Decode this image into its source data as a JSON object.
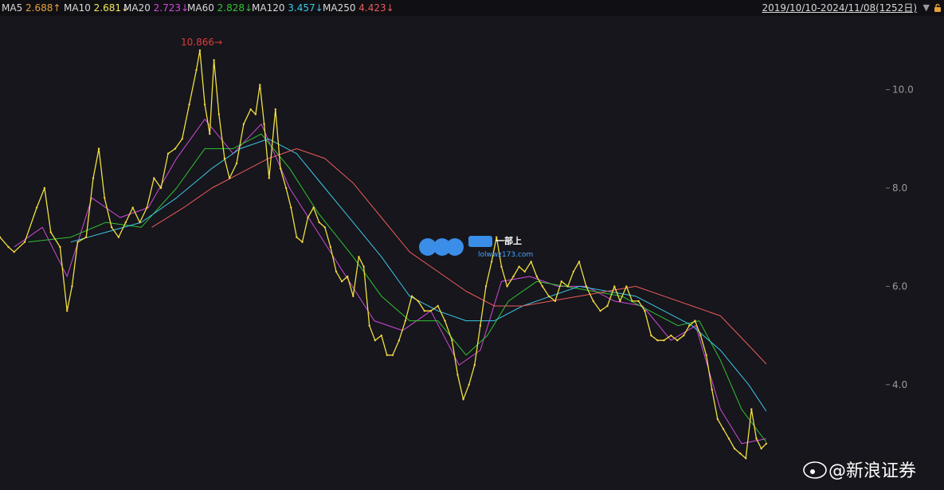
{
  "header": {
    "ma_items": [
      {
        "label": "MA5",
        "value": "2.688↑",
        "color": "#e6a23c"
      },
      {
        "label": "MA10",
        "value": "2.681↓",
        "color": "#f5e85a"
      },
      {
        "label": "MA20",
        "value": "2.723↓",
        "color": "#d04bd8"
      },
      {
        "label": "MA60",
        "value": "2.828↓",
        "color": "#32c232"
      },
      {
        "label": "MA120",
        "value": "3.457↓",
        "color": "#3cc8e6"
      },
      {
        "label": "MA250",
        "value": "4.423↓",
        "color": "#ee5a5a"
      }
    ],
    "range_label": "2019/10/10-2024/11/08(1252日)"
  },
  "chart_data": {
    "type": "line",
    "title": "",
    "xlabel": "",
    "ylabel": "",
    "ylim": [
      2.1,
      11.5
    ],
    "y_ticks": [
      {
        "value": 4.0,
        "label": "4.0"
      },
      {
        "value": 6.0,
        "label": "6.0"
      },
      {
        "value": 8.0,
        "label": "8.0"
      },
      {
        "value": 10.0,
        "label": "10.0"
      }
    ],
    "grid": false,
    "n_bars": 1252,
    "peak_annotation": {
      "label": "10.866→",
      "value": 10.866
    },
    "series": [
      {
        "name": "Price",
        "color": "#f0e040",
        "points": [
          [
            0,
            7.0
          ],
          [
            12,
            6.8
          ],
          [
            20,
            6.7
          ],
          [
            35,
            6.9
          ],
          [
            52,
            7.6
          ],
          [
            63,
            8.0
          ],
          [
            72,
            7.1
          ],
          [
            85,
            6.8
          ],
          [
            95,
            5.5
          ],
          [
            102,
            6.0
          ],
          [
            110,
            6.9
          ],
          [
            122,
            7.0
          ],
          [
            132,
            8.2
          ],
          [
            140,
            8.8
          ],
          [
            148,
            7.8
          ],
          [
            158,
            7.2
          ],
          [
            168,
            7.0
          ],
          [
            178,
            7.3
          ],
          [
            188,
            7.6
          ],
          [
            198,
            7.3
          ],
          [
            208,
            7.6
          ],
          [
            218,
            8.2
          ],
          [
            228,
            8.0
          ],
          [
            238,
            8.7
          ],
          [
            248,
            8.8
          ],
          [
            258,
            9.0
          ],
          [
            268,
            9.7
          ],
          [
            278,
            10.4
          ],
          [
            283,
            10.8
          ],
          [
            290,
            9.7
          ],
          [
            297,
            9.1
          ],
          [
            303,
            10.6
          ],
          [
            310,
            9.5
          ],
          [
            318,
            8.6
          ],
          [
            325,
            8.2
          ],
          [
            335,
            8.5
          ],
          [
            345,
            9.3
          ],
          [
            355,
            9.6
          ],
          [
            362,
            9.5
          ],
          [
            368,
            10.1
          ],
          [
            374,
            9.3
          ],
          [
            381,
            8.2
          ],
          [
            390,
            9.6
          ],
          [
            397,
            8.4
          ],
          [
            405,
            8.0
          ],
          [
            412,
            7.6
          ],
          [
            420,
            7.0
          ],
          [
            428,
            6.9
          ],
          [
            436,
            7.4
          ],
          [
            444,
            7.6
          ],
          [
            452,
            7.3
          ],
          [
            460,
            7.2
          ],
          [
            468,
            6.8
          ],
          [
            476,
            6.3
          ],
          [
            484,
            6.1
          ],
          [
            492,
            6.2
          ],
          [
            500,
            5.8
          ],
          [
            508,
            6.6
          ],
          [
            515,
            6.4
          ],
          [
            523,
            5.2
          ],
          [
            531,
            4.9
          ],
          [
            540,
            5.0
          ],
          [
            548,
            4.6
          ],
          [
            556,
            4.6
          ],
          [
            565,
            4.9
          ],
          [
            574,
            5.3
          ],
          [
            583,
            5.8
          ],
          [
            592,
            5.7
          ],
          [
            601,
            5.5
          ],
          [
            610,
            5.5
          ],
          [
            620,
            5.6
          ],
          [
            630,
            5.3
          ],
          [
            640,
            4.9
          ],
          [
            648,
            4.2
          ],
          [
            656,
            3.7
          ],
          [
            664,
            4.0
          ],
          [
            672,
            4.4
          ],
          [
            680,
            5.2
          ],
          [
            688,
            6.0
          ],
          [
            696,
            6.5
          ],
          [
            703,
            7.0
          ],
          [
            710,
            6.4
          ],
          [
            718,
            6.0
          ],
          [
            727,
            6.2
          ],
          [
            735,
            6.4
          ],
          [
            743,
            6.3
          ],
          [
            752,
            6.5
          ],
          [
            760,
            6.2
          ],
          [
            768,
            6.0
          ],
          [
            777,
            5.8
          ],
          [
            786,
            5.7
          ],
          [
            795,
            6.1
          ],
          [
            804,
            6.0
          ],
          [
            812,
            6.3
          ],
          [
            820,
            6.5
          ],
          [
            830,
            6.0
          ],
          [
            840,
            5.7
          ],
          [
            850,
            5.5
          ],
          [
            860,
            5.6
          ],
          [
            870,
            6.0
          ],
          [
            878,
            5.7
          ],
          [
            887,
            6.0
          ],
          [
            895,
            5.7
          ],
          [
            904,
            5.7
          ],
          [
            913,
            5.5
          ],
          [
            922,
            5.0
          ],
          [
            931,
            4.9
          ],
          [
            940,
            4.9
          ],
          [
            950,
            5.0
          ],
          [
            959,
            4.9
          ],
          [
            968,
            5.0
          ],
          [
            976,
            5.2
          ],
          [
            984,
            5.3
          ],
          [
            992,
            5.0
          ],
          [
            1000,
            4.6
          ],
          [
            1008,
            3.9
          ],
          [
            1016,
            3.3
          ],
          [
            1024,
            3.1
          ],
          [
            1032,
            2.9
          ],
          [
            1040,
            2.7
          ],
          [
            1048,
            2.6
          ],
          [
            1056,
            2.5
          ],
          [
            1064,
            3.5
          ],
          [
            1071,
            2.9
          ],
          [
            1078,
            2.7
          ],
          [
            1085,
            2.8
          ]
        ]
      },
      {
        "name": "MA20",
        "color": "#d04bd8",
        "points": [
          [
            20,
            6.8
          ],
          [
            60,
            7.2
          ],
          [
            95,
            6.2
          ],
          [
            130,
            7.8
          ],
          [
            170,
            7.4
          ],
          [
            210,
            7.6
          ],
          [
            250,
            8.6
          ],
          [
            290,
            9.4
          ],
          [
            330,
            8.7
          ],
          [
            370,
            9.3
          ],
          [
            410,
            8.0
          ],
          [
            450,
            7.1
          ],
          [
            490,
            6.2
          ],
          [
            530,
            5.3
          ],
          [
            570,
            5.1
          ],
          [
            610,
            5.5
          ],
          [
            650,
            4.4
          ],
          [
            680,
            4.7
          ],
          [
            710,
            6.1
          ],
          [
            750,
            6.2
          ],
          [
            790,
            6.0
          ],
          [
            830,
            6.0
          ],
          [
            870,
            5.7
          ],
          [
            910,
            5.6
          ],
          [
            950,
            4.9
          ],
          [
            985,
            5.2
          ],
          [
            1020,
            3.5
          ],
          [
            1050,
            2.8
          ],
          [
            1085,
            2.9
          ]
        ]
      },
      {
        "name": "MA60",
        "color": "#32c232",
        "points": [
          [
            40,
            6.9
          ],
          [
            100,
            7.0
          ],
          [
            150,
            7.3
          ],
          [
            200,
            7.2
          ],
          [
            250,
            8.0
          ],
          [
            290,
            8.8
          ],
          [
            330,
            8.8
          ],
          [
            370,
            9.1
          ],
          [
            410,
            8.4
          ],
          [
            450,
            7.5
          ],
          [
            500,
            6.6
          ],
          [
            540,
            5.8
          ],
          [
            580,
            5.3
          ],
          [
            620,
            5.3
          ],
          [
            660,
            4.6
          ],
          [
            690,
            5.0
          ],
          [
            720,
            5.7
          ],
          [
            760,
            6.1
          ],
          [
            800,
            6.0
          ],
          [
            840,
            5.9
          ],
          [
            880,
            5.8
          ],
          [
            920,
            5.5
          ],
          [
            960,
            5.2
          ],
          [
            990,
            5.3
          ],
          [
            1020,
            4.5
          ],
          [
            1050,
            3.5
          ],
          [
            1085,
            2.83
          ]
        ]
      },
      {
        "name": "MA120",
        "color": "#3cc8e6",
        "points": [
          [
            100,
            6.9
          ],
          [
            150,
            7.1
          ],
          [
            200,
            7.3
          ],
          [
            250,
            7.8
          ],
          [
            300,
            8.4
          ],
          [
            340,
            8.8
          ],
          [
            380,
            9.0
          ],
          [
            420,
            8.7
          ],
          [
            460,
            8.0
          ],
          [
            500,
            7.3
          ],
          [
            540,
            6.6
          ],
          [
            580,
            5.8
          ],
          [
            620,
            5.5
          ],
          [
            660,
            5.3
          ],
          [
            700,
            5.3
          ],
          [
            740,
            5.6
          ],
          [
            780,
            5.8
          ],
          [
            820,
            6.0
          ],
          [
            860,
            5.9
          ],
          [
            900,
            5.8
          ],
          [
            940,
            5.5
          ],
          [
            980,
            5.2
          ],
          [
            1020,
            4.7
          ],
          [
            1060,
            4.0
          ],
          [
            1085,
            3.46
          ]
        ]
      },
      {
        "name": "MA250",
        "color": "#ee5a5a",
        "points": [
          [
            215,
            7.2
          ],
          [
            260,
            7.6
          ],
          [
            300,
            8.0
          ],
          [
            340,
            8.3
          ],
          [
            380,
            8.6
          ],
          [
            420,
            8.8
          ],
          [
            460,
            8.6
          ],
          [
            500,
            8.1
          ],
          [
            540,
            7.4
          ],
          [
            580,
            6.7
          ],
          [
            620,
            6.3
          ],
          [
            660,
            5.9
          ],
          [
            700,
            5.6
          ],
          [
            740,
            5.6
          ],
          [
            780,
            5.7
          ],
          [
            820,
            5.8
          ],
          [
            860,
            5.9
          ],
          [
            900,
            6.0
          ],
          [
            940,
            5.8
          ],
          [
            980,
            5.6
          ],
          [
            1020,
            5.4
          ],
          [
            1060,
            4.8
          ],
          [
            1085,
            4.42
          ]
        ]
      }
    ]
  },
  "watermark": {
    "text": "@新浪证券",
    "logo_text": "一部上",
    "logo_url": "lolwwz173.com"
  }
}
